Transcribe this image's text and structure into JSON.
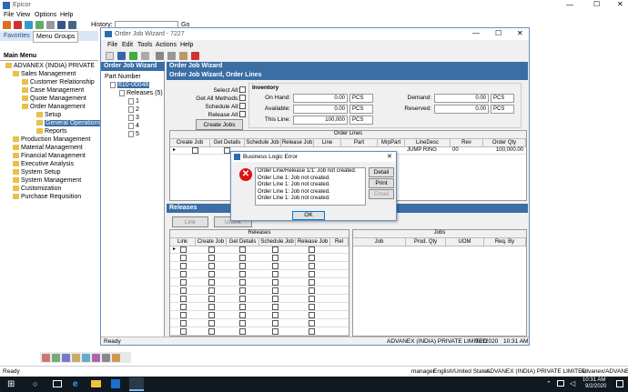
{
  "main_window": {
    "title": "Epicor",
    "menu": [
      "File",
      "View",
      "Options",
      "Help"
    ],
    "history_label": "History:",
    "go_label": "Go",
    "tabs": [
      "Favorites",
      "Menu Groups"
    ],
    "main_menu_title": "Main Menu",
    "tree": [
      "ADVANEX (INDIA) PRIVATE",
      "Sales Management",
      "Customer Relationship",
      "Case Management",
      "Quote Management",
      "Order Management",
      "Setup",
      "General Operations",
      "Reports",
      "Production Management",
      "Material Management",
      "Financial Management",
      "Executive Analysis",
      "System Setup",
      "System Management",
      "Customization",
      "Purchase Requisition"
    ],
    "status": "Ready",
    "status_user": "manager",
    "status_locale": "English/United States",
    "status_company": "ADVANEX (INDIA) PRIVATE LIMITED",
    "status_right": "Advanex/ADVANEXLIVE"
  },
  "wizard": {
    "title": "Order Job Wizard - 7227",
    "menu": [
      "File",
      "Edit",
      "Tools",
      "Actions",
      "Help"
    ],
    "tree_title": "Order Job Wizard",
    "tree_part": "Part Number",
    "tree_order": "610-00046",
    "tree_releases": "Releases (5)",
    "tree_items": [
      "1",
      "2",
      "3",
      "4",
      "5"
    ],
    "panel_title": "Order Job Wizard",
    "subpanel_title": "Order Job Wizard, Order Lines",
    "select_all": "Select All:",
    "get_all_methods": "Get All Methods:",
    "schedule_all": "Schedule All:",
    "release_all": "Release All:",
    "create_jobs": "Create Jobs",
    "inventory": "Inventory",
    "on_hand": "On Hand:",
    "on_hand_val": "0.00",
    "available": "Available:",
    "available_val": "0.00",
    "this_line": "This Line:",
    "this_line_val": "100,000",
    "uom": "PCS",
    "demand": "Demand:",
    "demand_val": "0.00",
    "reserved": "Reserved:",
    "reserved_val": "0.00",
    "order_lines": "Order Lines",
    "ol_cols": [
      "Create Job",
      "Get Details",
      "Schedule Job",
      "Release Job",
      "Line",
      "Part",
      "MrpPart",
      "LineDesc",
      "Rev",
      "Order Qty"
    ],
    "ol_row": {
      "desc": "JUMP RING",
      "rev": "00",
      "qty": "100,000.00"
    },
    "releases_title": "Releases",
    "link": "Link",
    "unlink": "Unlink",
    "rel_header": "Releases",
    "rel_cols": [
      "Link",
      "Create Job",
      "Get Details",
      "Schedule Job",
      "Release Job",
      "Rel"
    ],
    "jobs": "Jobs",
    "jobs_cols": [
      "Job",
      "Prod. Qty",
      "UOM",
      "Req. By"
    ],
    "status": "Ready",
    "status_company": "ADVANEX (INDIA) PRIVATE LIMITED",
    "status_date": "9/2/2020",
    "status_time": "10:31 AM"
  },
  "dialog": {
    "title": "Business Logic Error",
    "lines": [
      "Order Line/Release 1/1:  Job not created.",
      "Order Line 1:  Job not created.",
      "Order Line 1:  Job not created.",
      "Order Line 1:  Job not created.",
      "Order Line 1:  Job not created."
    ],
    "detail": "Detail",
    "print": "Print",
    "email": "Email",
    "ok": "OK"
  },
  "taskbar": {
    "time": "10:31 AM",
    "date": "9/2/2020"
  }
}
